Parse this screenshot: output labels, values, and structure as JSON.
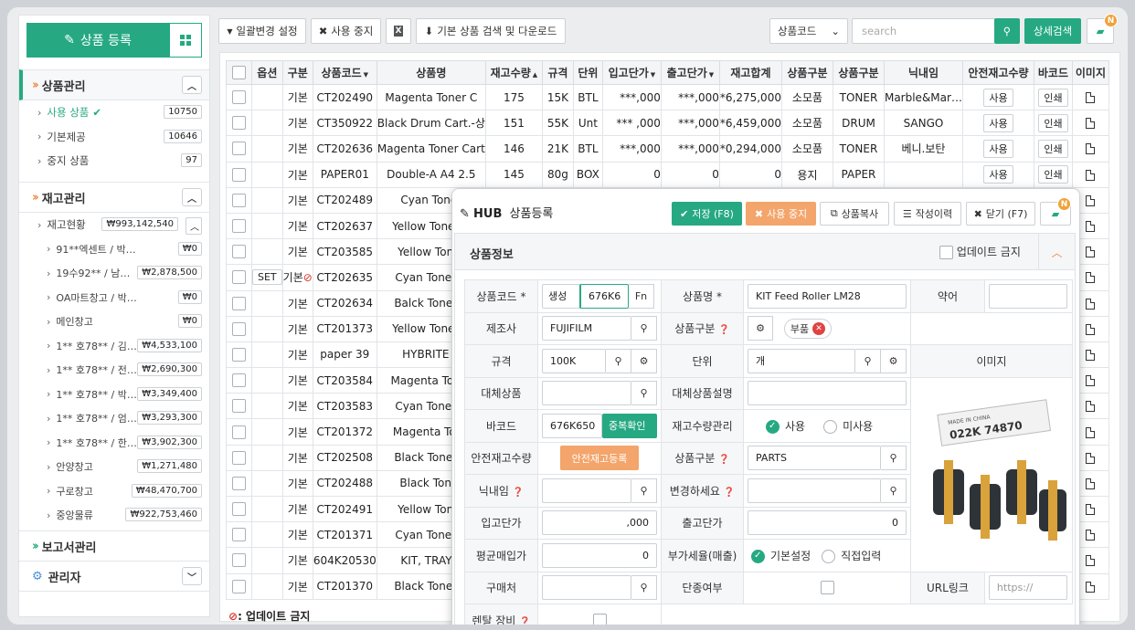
{
  "sidebar": {
    "register_label": "상품 등록",
    "sections": {
      "product": {
        "title": "상품관리",
        "items": [
          {
            "label": "사용 상품",
            "count": "10750"
          },
          {
            "label": "기본제공",
            "count": "10646"
          },
          {
            "label": "중지 상품",
            "count": "97"
          }
        ]
      },
      "stock": {
        "title": "재고관리",
        "root": {
          "label": "재고현황",
          "amount": "₩993,142,540"
        },
        "items": [
          {
            "label": "91**엑센트 / 박…",
            "amount": "₩0"
          },
          {
            "label": "19수92** / 남…",
            "amount": "₩2,878,500"
          },
          {
            "label": "OA마트창고 / 박…",
            "amount": "₩0"
          },
          {
            "label": "메인창고",
            "amount": "₩0"
          },
          {
            "label": "1** 호78** / 김…",
            "amount": "₩4,533,100"
          },
          {
            "label": "1** 호78** / 전…",
            "amount": "₩2,690,300"
          },
          {
            "label": "1** 호78** / 박…",
            "amount": "₩3,349,400"
          },
          {
            "label": "1** 호78** / 엄…",
            "amount": "₩3,293,300"
          },
          {
            "label": "1** 호78** / 한…",
            "amount": "₩3,902,300"
          },
          {
            "label": "안양창고",
            "amount": "₩1,271,480"
          },
          {
            "label": "구로창고",
            "amount": "₩48,470,700"
          },
          {
            "label": "중앙물류",
            "amount": "₩922,753,460"
          }
        ]
      },
      "report": {
        "title": "보고서관리"
      },
      "admin": {
        "title": "관리자"
      }
    }
  },
  "toolbar": {
    "bulk_change": "일괄변경 설정",
    "stop_use": "사용 중지",
    "excel": "X",
    "download": "기본 상품 검색 및 다운로드",
    "search_field": "상품코드",
    "search_placeholder": "search",
    "detail_search": "상세검색",
    "notif_badge": "N"
  },
  "table": {
    "headers": [
      "",
      "옵션",
      "구분",
      "상품코드",
      "상품명",
      "재고수량",
      "규격",
      "단위",
      "입고단가",
      "출고단가",
      "재고합계",
      "상품구분",
      "상품구분",
      "닉내임",
      "안전재고수량",
      "바코드",
      "이미지"
    ],
    "use_label": "사용",
    "print_label": "인쇄",
    "set_label": "SET",
    "rows": [
      {
        "kind": "기본",
        "code": "CT202490",
        "name": "Magenta Toner C",
        "stock": "175",
        "spec": "15K",
        "unit": "BTL",
        "in": "***,000",
        "out": "***,000",
        "total": "*6,275,000",
        "cat1": "소모품",
        "cat2": "TONER",
        "nick": "Marble&Mar…"
      },
      {
        "kind": "기본",
        "code": "CT350922",
        "name": "Black Drum Cart.-상",
        "stock": "151",
        "spec": "55K",
        "unit": "Unt",
        "in": "*** ,000",
        "out": "***,000",
        "total": "*6,459,000",
        "cat1": "소모품",
        "cat2": "DRUM",
        "nick": "SANGO"
      },
      {
        "kind": "기본",
        "code": "CT202636",
        "name": "Magenta Toner Cart",
        "stock": "146",
        "spec": "21K",
        "unit": "BTL",
        "in": "***,000",
        "out": "***,000",
        "total": "*0,294,000",
        "cat1": "소모품",
        "cat2": "TONER",
        "nick": "베니.보탄"
      },
      {
        "kind": "기본",
        "code": "PAPER01",
        "name": "Double-A  A4 2.5",
        "stock": "145",
        "spec": "80g",
        "unit": "BOX",
        "in": "0",
        "out": "0",
        "total": "0",
        "cat1": "용지",
        "cat2": "PAPER",
        "nick": ""
      },
      {
        "kind": "기본",
        "code": "CT202489",
        "name": "Cyan Toner",
        "stock": "",
        "spec": "",
        "unit": "",
        "in": "",
        "out": "",
        "total": "",
        "cat1": "",
        "cat2": "",
        "nick": ""
      },
      {
        "kind": "기본",
        "code": "CT202637",
        "name": "Yellow Toner C",
        "stock": "",
        "spec": "",
        "unit": "",
        "in": "",
        "out": "",
        "total": "",
        "cat1": "",
        "cat2": "",
        "nick": ""
      },
      {
        "kind": "기본",
        "code": "CT203585",
        "name": "Yellow Toner",
        "stock": "",
        "spec": "",
        "unit": "",
        "in": "",
        "out": "",
        "total": "",
        "cat1": "",
        "cat2": "",
        "nick": ""
      },
      {
        "kind": "기본",
        "code": "CT202635",
        "name": "Cyan Toner C",
        "stock": "",
        "spec": "",
        "unit": "",
        "in": "",
        "out": "",
        "total": "",
        "cat1": "",
        "cat2": "",
        "nick": "",
        "set": true
      },
      {
        "kind": "기본",
        "code": "CT202634",
        "name": "Balck Toner C",
        "stock": "",
        "spec": "",
        "unit": "",
        "in": "",
        "out": "",
        "total": "",
        "cat1": "",
        "cat2": "",
        "nick": ""
      },
      {
        "kind": "기본",
        "code": "CT201373",
        "name": "Yellow  Toner C",
        "stock": "",
        "spec": "",
        "unit": "",
        "in": "",
        "out": "",
        "total": "",
        "cat1": "",
        "cat2": "",
        "nick": ""
      },
      {
        "kind": "기본",
        "code": "paper 39",
        "name": "HYBRITE A",
        "stock": "",
        "spec": "",
        "unit": "",
        "in": "",
        "out": "",
        "total": "",
        "cat1": "",
        "cat2": "",
        "nick": ""
      },
      {
        "kind": "기본",
        "code": "CT203584",
        "name": "Magenta Toner",
        "stock": "",
        "spec": "",
        "unit": "",
        "in": "",
        "out": "",
        "total": "",
        "cat1": "",
        "cat2": "",
        "nick": ""
      },
      {
        "kind": "기본",
        "code": "CT203583",
        "name": "Cyan Toner C",
        "stock": "",
        "spec": "",
        "unit": "",
        "in": "",
        "out": "",
        "total": "",
        "cat1": "",
        "cat2": "",
        "nick": ""
      },
      {
        "kind": "기본",
        "code": "CT201372",
        "name": "Magenta  Tone",
        "stock": "",
        "spec": "",
        "unit": "",
        "in": "",
        "out": "",
        "total": "",
        "cat1": "",
        "cat2": "",
        "nick": ""
      },
      {
        "kind": "기본",
        "code": "CT202508",
        "name": "Black Toner C",
        "stock": "",
        "spec": "",
        "unit": "",
        "in": "",
        "out": "",
        "total": "",
        "cat1": "",
        "cat2": "",
        "nick": ""
      },
      {
        "kind": "기본",
        "code": "CT202488",
        "name": "Black Toner",
        "stock": "",
        "spec": "",
        "unit": "",
        "in": "",
        "out": "",
        "total": "",
        "cat1": "",
        "cat2": "",
        "nick": ""
      },
      {
        "kind": "기본",
        "code": "CT202491",
        "name": "Yellow Toner",
        "stock": "",
        "spec": "",
        "unit": "",
        "in": "",
        "out": "",
        "total": "",
        "cat1": "",
        "cat2": "",
        "nick": ""
      },
      {
        "kind": "기본",
        "code": "CT201371",
        "name": "Cyan Toner C",
        "stock": "",
        "spec": "",
        "unit": "",
        "in": "",
        "out": "",
        "total": "",
        "cat1": "",
        "cat2": "",
        "nick": ""
      },
      {
        "kind": "기본",
        "code": "604K20530",
        "name": "KIT, TRAY F",
        "stock": "",
        "spec": "",
        "unit": "",
        "in": "",
        "out": "",
        "total": "",
        "cat1": "",
        "cat2": "",
        "nick": ""
      },
      {
        "kind": "기본",
        "code": "CT201370",
        "name": "Black Toner C",
        "stock": "",
        "spec": "",
        "unit": "",
        "in": "",
        "out": "",
        "total": "",
        "cat1": "",
        "cat2": "",
        "nick": ""
      }
    ],
    "footer_note": ": 업데이트 금지"
  },
  "modal": {
    "brand": "HUB",
    "title": "상품등록",
    "save": "저장 (F8)",
    "stop": "사용 중지",
    "copy": "상품복사",
    "history": "작성이력",
    "close": "닫기 (F7)",
    "badge": "N",
    "section_title": "상품정보",
    "update_lock": "업데이트 금지",
    "labels": {
      "code": "상품코드 *",
      "name": "상품명 *",
      "abbr": "약어",
      "maker": "제조사",
      "category": "상품구분",
      "spec": "규격",
      "unit": "단위",
      "image": "이미지",
      "alt": "대체상품",
      "alt_desc": "대체상품설명",
      "barcode": "바코드",
      "stock_mgmt": "재고수량관리",
      "safety": "안전재고수량",
      "category2": "상품구분",
      "nick": "닉내임",
      "change": "변경하세요",
      "in_price": "입고단가",
      "out_price": "출고단가",
      "avg_price": "평균매입가",
      "vat": "부가세율(매출)",
      "buyer": "구매처",
      "discontinued": "단종여부",
      "url": "URL링크",
      "rental": "렌탈 장비"
    },
    "values": {
      "gen": "생성",
      "code": "676K6",
      "fn": "Fn",
      "name": "KIT Feed Roller LM28",
      "maker": "FUJIFILM",
      "category_tag": "부품",
      "spec": "100K",
      "unit": "개",
      "barcode": "676K650",
      "dup_check": "중복확인",
      "use": "사용",
      "unused": "미사용",
      "safety_btn": "안전재고등록",
      "category2": "PARTS",
      "in_price": ",000",
      "out_price": "0",
      "avg_price": "0",
      "vat_default": "기본설정",
      "vat_direct": "직접입력",
      "url_placeholder": "https://",
      "img_label": "022K 74870",
      "img_tag": "MADE IN CHINA"
    }
  }
}
